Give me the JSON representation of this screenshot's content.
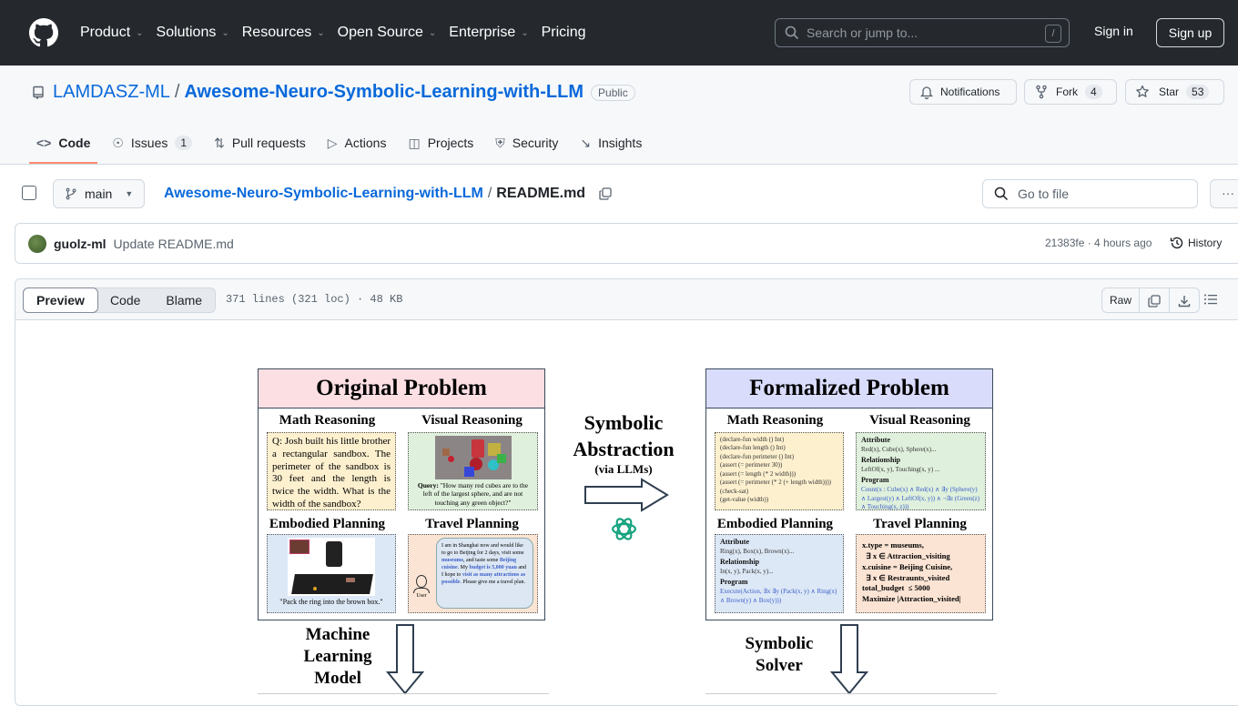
{
  "topnav": {
    "items": [
      {
        "label": "Product",
        "has_menu": true
      },
      {
        "label": "Solutions",
        "has_menu": true
      },
      {
        "label": "Resources",
        "has_menu": true
      },
      {
        "label": "Open Source",
        "has_menu": true
      },
      {
        "label": "Enterprise",
        "has_menu": true
      },
      {
        "label": "Pricing",
        "has_menu": false
      }
    ],
    "search_placeholder": "Search or jump to...",
    "search_shortcut": "/",
    "sign_in": "Sign in",
    "sign_up": "Sign up"
  },
  "repo": {
    "owner": "LAMDASZ-ML",
    "separator": "/",
    "name": "Awesome-Neuro-Symbolic-Learning-with-LLM",
    "visibility": "Public",
    "notifications_label": "Notifications",
    "fork_label": "Fork",
    "fork_count": "4",
    "star_label": "Star",
    "star_count": "53"
  },
  "tabs": [
    {
      "label": "Code",
      "icon": "code-icon",
      "active": true
    },
    {
      "label": "Issues",
      "icon": "issue-icon",
      "count": "1"
    },
    {
      "label": "Pull requests",
      "icon": "pull-request-icon"
    },
    {
      "label": "Actions",
      "icon": "play-icon"
    },
    {
      "label": "Projects",
      "icon": "table-icon"
    },
    {
      "label": "Security",
      "icon": "shield-icon"
    },
    {
      "label": "Insights",
      "icon": "graph-icon"
    }
  ],
  "file": {
    "branch": "main",
    "repo_link": "Awesome-Neuro-Symbolic-Learning-with-LLM",
    "separator": "/",
    "filename": "README.md",
    "goto_placeholder": "Go to file",
    "more": "···"
  },
  "commit": {
    "author": "guolz-ml",
    "message": "Update README.md",
    "meta": "21383fe · 4 hours ago",
    "history": "History"
  },
  "viewer": {
    "modes": [
      "Preview",
      "Code",
      "Blame"
    ],
    "active_mode": "Preview",
    "meta": "371 lines (321 loc) · 48 KB",
    "raw": "Raw"
  },
  "figure": {
    "left_panel": {
      "title": "Original Problem",
      "title_bg": "#fcdfe3",
      "math_title": "Math Reasoning",
      "math_text": "Q: Josh built his little brother a rectangular sandbox. The perimeter of the sandbox is 30 feet and the length is twice the width. What is the width of the sandbox?",
      "visual_title": "Visual Reasoning",
      "visual_query_label": "Query:",
      "visual_query": "\"How many red cubes are to the left of the largest sphere, and are not touching any green object?\"",
      "embodied_title": "Embodied Planning",
      "embodied_caption": "\"Pack the ring into the brown box.\"",
      "travel_title": "Travel Planning",
      "travel_user": "User",
      "travel_text_parts": [
        {
          "t": "I am in Shanghai now and would like to go to Beijing for 2 days, visit some ",
          "hl": false
        },
        {
          "t": "museums",
          "hl": true
        },
        {
          "t": ", and taste some ",
          "hl": false
        },
        {
          "t": "Beijing cuisine",
          "hl": true
        },
        {
          "t": ". My ",
          "hl": false
        },
        {
          "t": "budget is 5,000 yuan",
          "hl": true
        },
        {
          "t": " and I hope to ",
          "hl": false
        },
        {
          "t": "visit as many attractions as possible",
          "hl": true
        },
        {
          "t": ". Please give me a travel plan.",
          "hl": false
        }
      ]
    },
    "middle": {
      "title_line1": "Symbolic",
      "title_line2": "Abstraction",
      "subtitle": "(via LLMs)"
    },
    "right_panel": {
      "title": "Formalized Problem",
      "title_bg": "#d9dcfb",
      "math_title": "Math Reasoning",
      "math_code": [
        "(declare-fun width () Int)",
        "(declare-fun length () Int)",
        "(declare-fun perimeter () Int)",
        "(assert (= perimeter 30))",
        "(assert (= length (* 2 width)))",
        "(assert (= perimeter (* 2 (+ length width))))",
        "(check-sat)",
        "(get-value (width))"
      ],
      "visual_title": "Visual Reasoning",
      "visual_attribute_label": "Attribute",
      "visual_attribute": "Red(x), Cube(x), Sphere(x)...",
      "visual_relationship_label": "Relationship",
      "visual_relationship": "LeftOf(x, y), Touching(x, y) ...",
      "visual_program_label": "Program",
      "visual_program": "Count(x : Cube(x) ∧ Red(x) ∧ ∃y (Sphere(y) ∧ Largest(y) ∧ LeftOf(x, y)) ∧ ¬∃z (Green(z) ∧ Touching(x, z)))",
      "embodied_title": "Embodied Planning",
      "embodied_attribute_label": "Attribute",
      "embodied_attribute": "Ring(x), Box(x), Brown(x)...",
      "embodied_relationship_label": "Relationship",
      "embodied_relationship": "In(x, y), Pack(x, y)...",
      "embodied_program_label": "Program",
      "embodied_program": "Execute(Action, ∃x ∃y (Pack(x, y) ∧ Ring(x) ∧ Brown(y) ∧ Box(y)))",
      "travel_title": "Travel Planning",
      "travel_lines": [
        "x.type = museums,",
        "  ∃ x ∈ Attraction_visiting",
        "x.cuisine = Beijing Cuisine,",
        "  ∃ x ∈ Restraunts_visited",
        "total_budget  ≤ 5000",
        "Maximize |Attraction_visited|"
      ]
    },
    "bottom_left": [
      "Machine",
      "Learning",
      "Model"
    ],
    "bottom_right": [
      "Symbolic",
      "Solver"
    ]
  }
}
